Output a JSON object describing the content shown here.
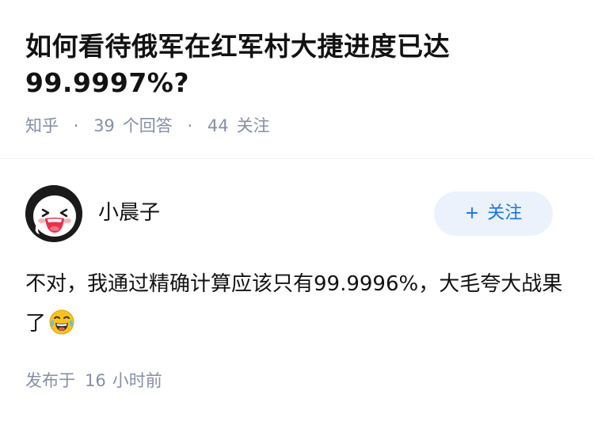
{
  "question": {
    "title": "如何看待俄军在红军村大捷进度已达99.9997%?",
    "source": "知乎",
    "separator": "·",
    "answer_count": "39",
    "answer_label": "个回答",
    "follower_count": "44",
    "follower_label": "关注"
  },
  "answer": {
    "author_name": "小晨子",
    "avatar_icon": "crying-laughing-ghost-avatar",
    "follow_plus": "+",
    "follow_label": "关注",
    "content": "不对，我通过精确计算应该只有99.9996%，大毛夸大战果了",
    "content_emoji": "tears-of-joy-emoji",
    "time_prefix": "发布于",
    "time_value": "16",
    "time_unit": "小时前"
  },
  "colors": {
    "text": "#121212",
    "muted": "#8590a6",
    "accent": "#1772f6",
    "button_bg": "#ebf2fc"
  }
}
